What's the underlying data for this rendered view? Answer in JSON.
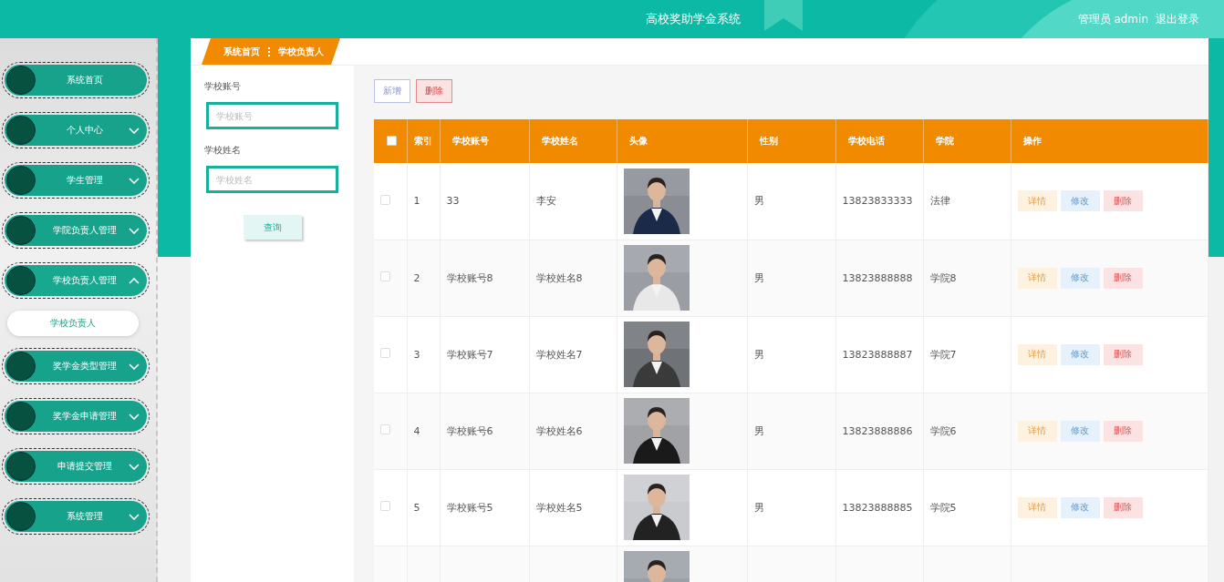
{
  "header": {
    "title": "高校奖助学金系统",
    "user": "管理员 admin",
    "logout": "退出登录"
  },
  "sidebar": {
    "items": [
      {
        "label": "系统首页",
        "kind": "link"
      },
      {
        "label": "个人中心",
        "kind": "menu",
        "expanded": false
      },
      {
        "label": "学生管理",
        "kind": "menu",
        "expanded": false
      },
      {
        "label": "学院负责人管理",
        "kind": "menu",
        "expanded": false
      },
      {
        "label": "学校负责人管理",
        "kind": "menu",
        "expanded": true,
        "children": [
          {
            "label": "学校负责人",
            "selected": true
          }
        ]
      },
      {
        "label": "奖学金类型管理",
        "kind": "menu",
        "expanded": false
      },
      {
        "label": "奖学金申请管理",
        "kind": "menu",
        "expanded": false
      },
      {
        "label": "申请提交管理",
        "kind": "menu",
        "expanded": false
      },
      {
        "label": "系统管理",
        "kind": "menu",
        "expanded": false
      }
    ]
  },
  "breadcrumb": [
    "系统首页",
    "学校负责人"
  ],
  "search": {
    "fields": [
      {
        "label": "学校账号",
        "placeholder": "学校账号"
      },
      {
        "label": "学校姓名",
        "placeholder": "学校姓名"
      }
    ],
    "button": "查询"
  },
  "toolbar": [
    {
      "label": "新增",
      "kind": "add"
    },
    {
      "label": "删除",
      "kind": "delete"
    }
  ],
  "table": {
    "select_all": {
      "checked": false
    },
    "columns": [
      "索引",
      "学校账号",
      "学校姓名",
      "头像",
      "性别",
      "学校电话",
      "学院",
      "操作"
    ],
    "rows": [
      {
        "checked": false,
        "cells": [
          "1",
          "33",
          "李安",
          {
            "kind": "picture"
          },
          "男",
          "13823833333",
          "法律"
        ],
        "actions": [
          "详情",
          "修改",
          "删除"
        ]
      },
      {
        "checked": false,
        "cells": [
          "2",
          "学校账号8",
          "学校姓名8",
          {
            "kind": "picture"
          },
          "男",
          "13823888888",
          "学院8"
        ],
        "actions": [
          "详情",
          "修改",
          "删除"
        ]
      },
      {
        "checked": false,
        "cells": [
          "3",
          "学校账号7",
          "学校姓名7",
          {
            "kind": "picture"
          },
          "男",
          "13823888887",
          "学院7"
        ],
        "actions": [
          "详情",
          "修改",
          "删除"
        ]
      },
      {
        "checked": false,
        "cells": [
          "4",
          "学校账号6",
          "学校姓名6",
          {
            "kind": "picture"
          },
          "男",
          "13823888886",
          "学院6"
        ],
        "actions": [
          "详情",
          "修改",
          "删除"
        ]
      },
      {
        "checked": false,
        "cells": [
          "5",
          "学校账号5",
          "学校姓名5",
          {
            "kind": "picture"
          },
          "男",
          "13823888885",
          "学院5"
        ],
        "actions": [
          "详情",
          "修改",
          "删除"
        ]
      },
      {
        "cells": [
          null,
          null,
          null,
          {
            "kind": "picture"
          }
        ]
      }
    ]
  }
}
